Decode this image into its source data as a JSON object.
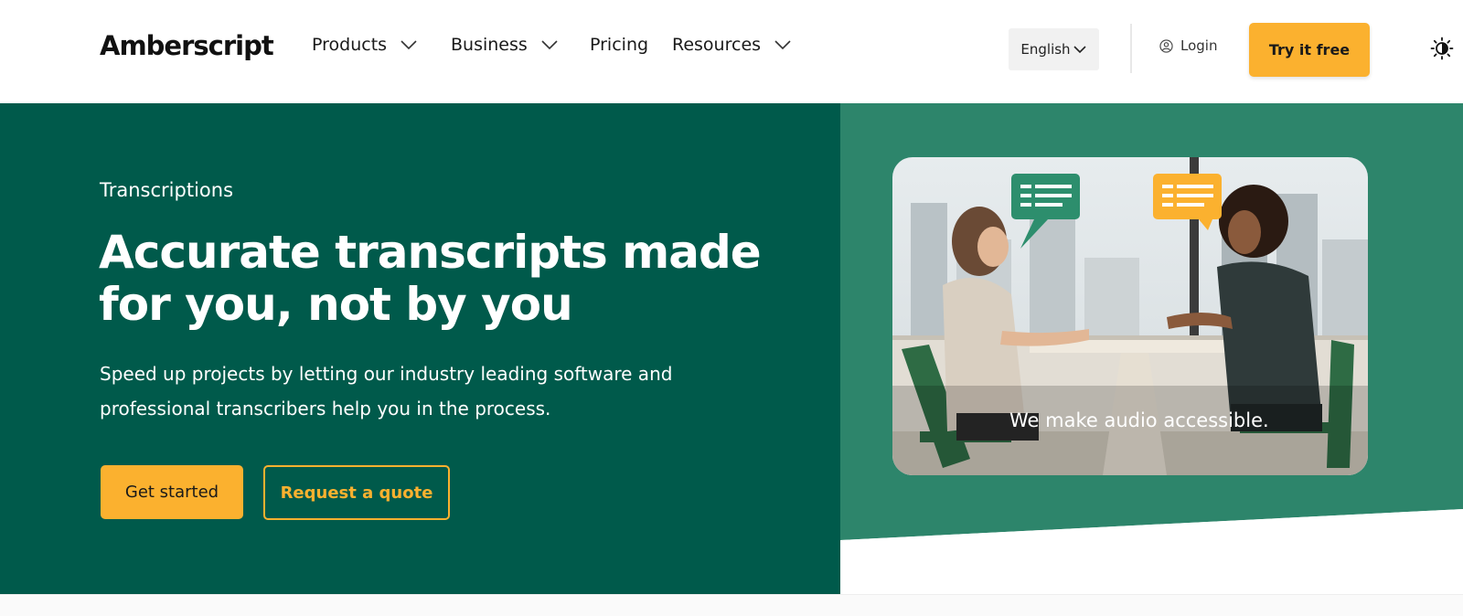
{
  "header": {
    "logo": "Amberscript",
    "nav": [
      {
        "label": "Products"
      },
      {
        "label": "Business"
      },
      {
        "label": "Pricing"
      },
      {
        "label": "Resources"
      }
    ],
    "language": "English",
    "login_label": "Login",
    "cta_label": "Try it free"
  },
  "hero": {
    "eyebrow": "Transcriptions",
    "headline": "Accurate transcripts made for you, not by you",
    "subtext": "Speed up projects by letting our industry leading software and professional transcribers help you in the process.",
    "primary_button": "Get started",
    "secondary_button": "Request a quote",
    "image_caption": "We make audio accessible."
  },
  "colors": {
    "accent": "#fbb12f",
    "hero_dark_green": "#005a4b",
    "hero_mid_green": "#2d856b"
  }
}
